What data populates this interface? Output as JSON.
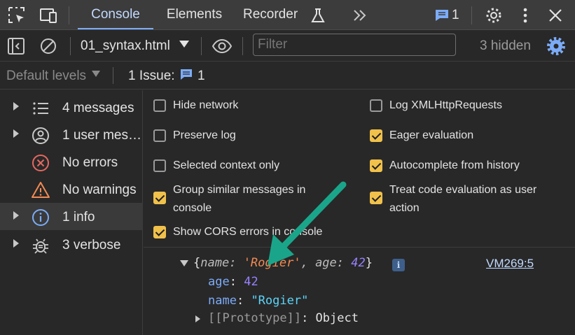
{
  "tabs": [
    {
      "label": "Console",
      "active": true
    },
    {
      "label": "Elements",
      "active": false
    },
    {
      "label": "Recorder",
      "active": false
    }
  ],
  "issues_badge_count": "1",
  "toolbar": {
    "context": "01_syntax.html",
    "filter_placeholder": "Filter",
    "hidden_count": "3 hidden"
  },
  "levels": {
    "default_levels": "Default levels",
    "issue_label": "1 Issue:",
    "issue_count": "1"
  },
  "sidebar": {
    "items": [
      {
        "label": "4 messages",
        "icon": "list-icon"
      },
      {
        "label": "1 user mes…",
        "icon": "user-icon"
      },
      {
        "label": "No errors",
        "icon": "error-icon"
      },
      {
        "label": "No warnings",
        "icon": "warning-icon"
      },
      {
        "label": "1 info",
        "icon": "info-icon"
      },
      {
        "label": "3 verbose",
        "icon": "bug-icon"
      }
    ]
  },
  "settings": {
    "left": [
      {
        "label": "Hide network",
        "checked": false
      },
      {
        "label": "Preserve log",
        "checked": false
      },
      {
        "label": "Selected context only",
        "checked": false
      },
      {
        "label": "Group similar messages in console",
        "line1": "Group similar messages in",
        "line2": "console",
        "checked": true
      },
      {
        "label": "Show CORS errors in console",
        "checked": true
      }
    ],
    "right": [
      {
        "label": "Log XMLHttpRequests",
        "checked": false
      },
      {
        "label": "Eager evaluation",
        "checked": true
      },
      {
        "label": "Autocomplete from history",
        "checked": true
      },
      {
        "label": "Treat code evaluation as user action",
        "line1": "Treat code evaluation as user",
        "line2": "action",
        "checked": true
      }
    ]
  },
  "console": {
    "summary_open": "{",
    "summary_key1": "name",
    "summary_val1": "'Rogier'",
    "summary_key2": "age",
    "summary_val2": "42",
    "summary_close": "}",
    "source_link": "VM269:5",
    "prop_age_key": "age",
    "prop_age_val": "42",
    "prop_name_key": "name",
    "prop_name_val": "\"Rogier\"",
    "prototype_key": "[[Prototype]]",
    "prototype_val": "Object"
  },
  "colors": {
    "accent": "#7cacf8",
    "checkbox_on": "#f0c14b",
    "arrow_annotation": "#1aa58a"
  }
}
